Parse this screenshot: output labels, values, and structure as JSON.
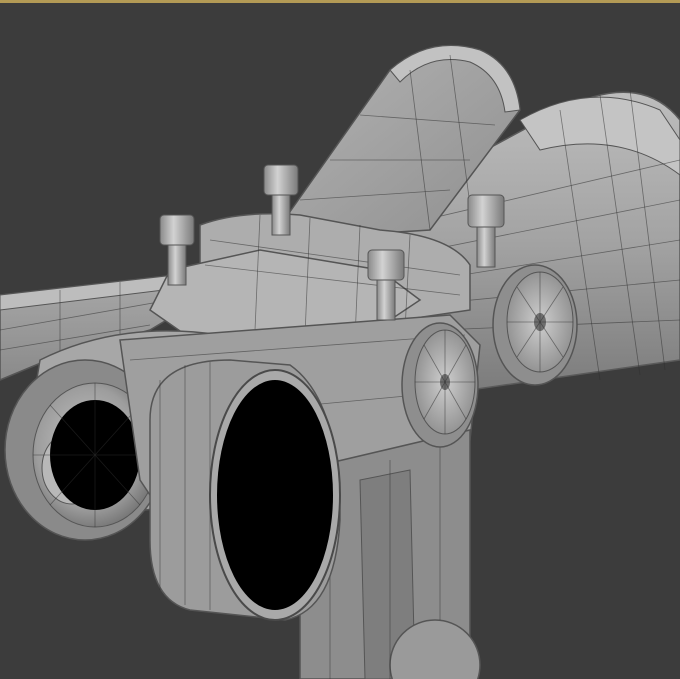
{
  "viewport": {
    "background_color": "#3c3c3c",
    "frame_accent_color": "#b39a55",
    "mesh_base_color": "#9a9a9a",
    "mesh_highlight_color": "#c9c9c9",
    "mesh_shadow_color": "#6e6e6e",
    "wireframe_color": "#2f2f2f",
    "render_mode": "shaded-with-wireframe"
  },
  "model": {
    "parts": [
      "rear-wing-fin",
      "main-body-cylinder",
      "left-wing-plate",
      "front-nozzle",
      "front-ring-cap",
      "side-round-cap",
      "side-disc-left",
      "side-disc-right",
      "top-bolt",
      "lower-pylon"
    ],
    "bolt_count": 4
  }
}
